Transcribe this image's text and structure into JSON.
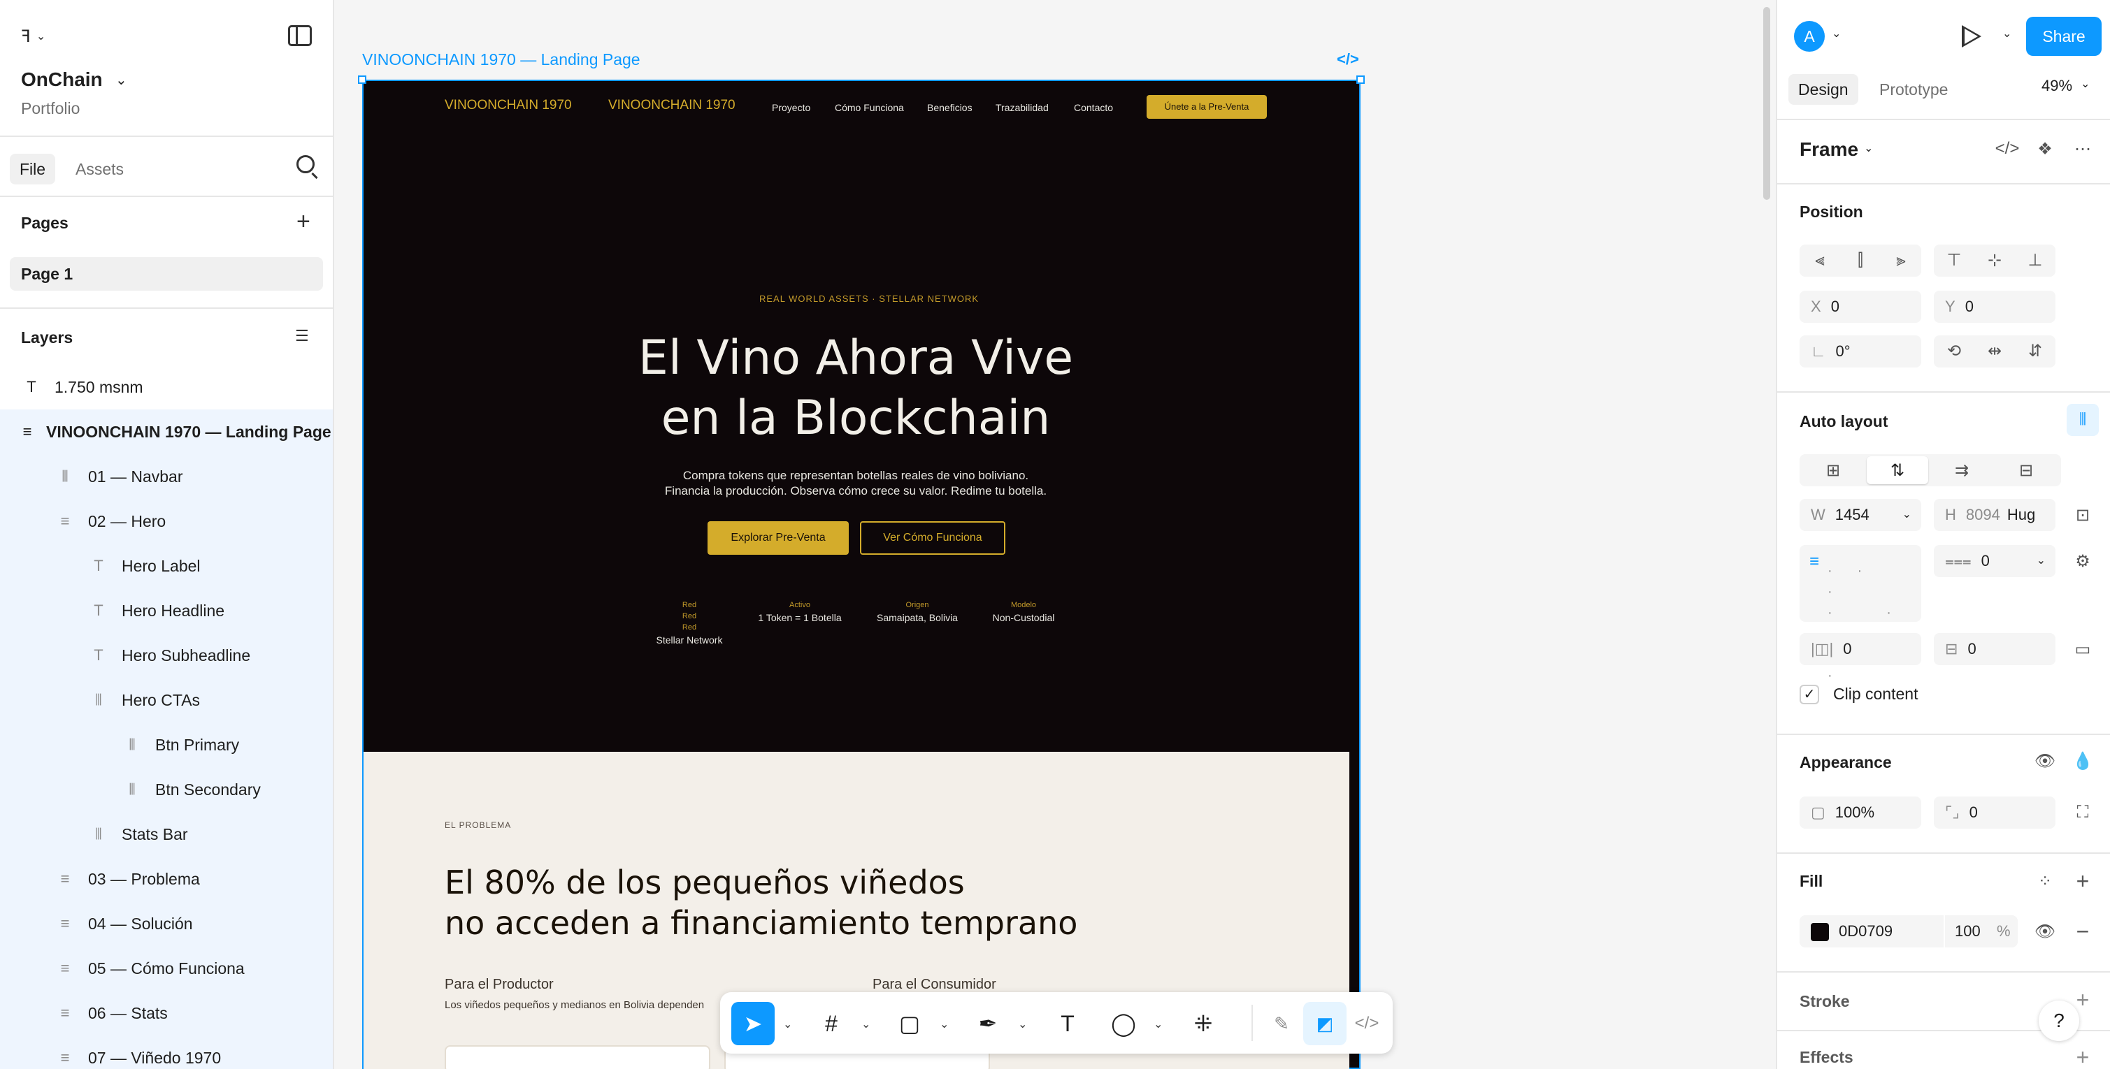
{
  "left_panel": {
    "project_name": "OnChain",
    "project_sub": "Portfolio",
    "tabs": [
      "File",
      "Assets"
    ],
    "pages_title": "Pages",
    "page_item": "Page 1",
    "layers_title": "Layers",
    "layers": [
      {
        "label": "1.750 msnm",
        "icon": "text-icon"
      },
      {
        "label": "VINOONCHAIN 1970 — Landing Page",
        "icon": "frame-layout-icon"
      },
      {
        "label": "01 — Navbar",
        "icon": "autolayout-horizontal-icon"
      },
      {
        "label": "02 — Hero",
        "icon": "frame-layout-icon"
      },
      {
        "label": "Hero Label",
        "icon": "text-icon"
      },
      {
        "label": "Hero Headline",
        "icon": "text-icon"
      },
      {
        "label": "Hero Subheadline",
        "icon": "text-icon"
      },
      {
        "label": "Hero CTAs",
        "icon": "autolayout-horizontal-icon"
      },
      {
        "label": "Btn Primary",
        "icon": "autolayout-horizontal-icon"
      },
      {
        "label": "Btn Secondary",
        "icon": "autolayout-horizontal-icon"
      },
      {
        "label": "Stats Bar",
        "icon": "autolayout-horizontal-icon"
      },
      {
        "label": "03 — Problema",
        "icon": "frame-layout-icon"
      },
      {
        "label": "04 — Solución",
        "icon": "frame-layout-icon"
      },
      {
        "label": "05 — Cómo Funciona",
        "icon": "frame-layout-icon"
      },
      {
        "label": "06 — Stats",
        "icon": "frame-layout-icon"
      },
      {
        "label": "07 — Viñedo 1970",
        "icon": "frame-layout-icon"
      }
    ]
  },
  "canvas": {
    "frame_label": "VINOONCHAIN 1970 — Landing Page",
    "landing": {
      "nav_brand_1": "VINOONCHAIN 1970",
      "nav_brand_2": "VINOONCHAIN 1970",
      "nav_links": [
        "Proyecto",
        "Cómo Funciona",
        "Beneficios",
        "Trazabilidad",
        "Contacto"
      ],
      "nav_cta": "Únete a la Pre-Venta",
      "hero_label": "REAL WORLD ASSETS · STELLAR NETWORK",
      "hero_headline_1": "El Vino Ahora Vive",
      "hero_headline_2": "en la Blockchain",
      "hero_sub_1": "Compra tokens que representan botellas reales de vino boliviano.",
      "hero_sub_2": "Financia la producción. Observa cómo crece su valor. Redime tu botella.",
      "btn_primary": "Explorar Pre-Venta",
      "btn_secondary": "Ver Cómo Funciona",
      "stats": [
        {
          "keys": [
            "Red",
            "Red",
            "Red"
          ],
          "value": "Stellar Network"
        },
        {
          "keys": [
            "Activo"
          ],
          "value": "1 Token = 1 Botella"
        },
        {
          "keys": [
            "Origen"
          ],
          "value": "Samaipata, Bolivia"
        },
        {
          "keys": [
            "Modelo"
          ],
          "value": "Non-Custodial"
        }
      ],
      "problem_label": "EL PROBLEMA",
      "problem_h_1": "El 80% de los pequeños viñedos",
      "problem_h_2": "no acceden a financiamiento temprano",
      "col1_title": "Para el Productor",
      "col1_text": "Los viñedos pequeños y medianos en Bolivia dependen",
      "col2_title": "Para el Consumidor"
    }
  },
  "right_panel": {
    "avatar_letter": "A",
    "share_label": "Share",
    "tabs": [
      "Design",
      "Prototype"
    ],
    "zoom": "49%",
    "frame_title": "Frame",
    "position_title": "Position",
    "x_label": "X",
    "x_value": "0",
    "y_label": "Y",
    "y_value": "0",
    "rotation": "0°",
    "auto_layout_title": "Auto layout",
    "w_label": "W",
    "w_value": "1454",
    "h_label": "H",
    "h_value": "8094",
    "h_mode": "Hug",
    "gap_value": "0",
    "pad_h_value": "0",
    "pad_v_value": "0",
    "clip_content": "Clip content",
    "appearance_title": "Appearance",
    "opacity": "100%",
    "radius": "0",
    "fill_title": "Fill",
    "fill_hex": "0D0709",
    "fill_opacity": "100",
    "fill_pct": "%",
    "stroke_title": "Stroke",
    "effects_title": "Effects"
  },
  "colors": {
    "accent": "#0d99ff",
    "frame_bg": "#0d0709",
    "gold": "#d4ac2b",
    "problem_bg": "#f3efe9"
  }
}
